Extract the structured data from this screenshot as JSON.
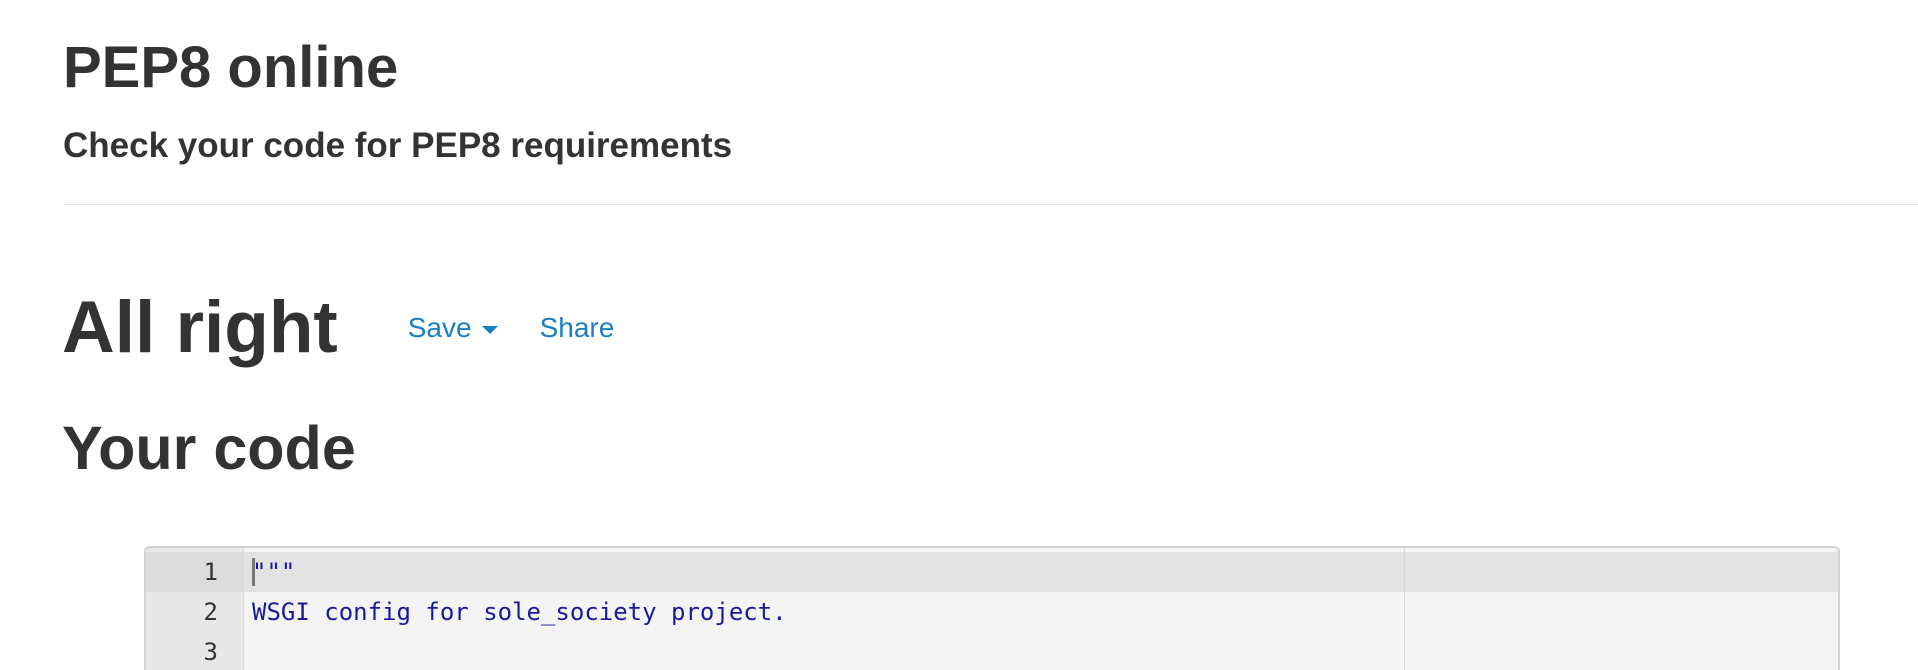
{
  "header": {
    "title": "PEP8 online",
    "subtitle": "Check your code for PEP8 requirements"
  },
  "result": {
    "heading": "All right",
    "save_label": "Save",
    "share_label": "Share"
  },
  "code_section": {
    "heading": "Your code",
    "lines": [
      {
        "number": "1",
        "text": "\"\"\""
      },
      {
        "number": "2",
        "text": "WSGI config for sole_society project."
      },
      {
        "number": "3",
        "text": ""
      }
    ]
  },
  "colors": {
    "link": "#1a7fc1",
    "code_text": "#1a1a99",
    "heading_text": "#333333"
  }
}
